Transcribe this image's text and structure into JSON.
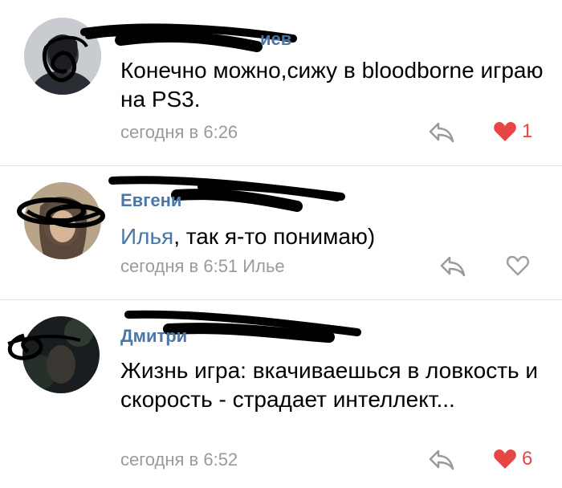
{
  "comments": [
    {
      "name_visible": "иев",
      "text": "Конечно можно,сижу в bloodborne играю на PS3.",
      "time": "сегодня в 6:26",
      "likes": "1",
      "liked": true,
      "icons": {
        "reply": "reply-arrow-icon",
        "like": "heart-filled-icon"
      }
    },
    {
      "name_visible": "Евгени",
      "mention": "Илья",
      "text_after_mention": ", так я-то понимаю)",
      "time": "сегодня в 6:51",
      "reply_to": "Илье",
      "likes": "",
      "liked": false,
      "icons": {
        "reply": "reply-arrow-icon",
        "like": "heart-outline-icon"
      }
    },
    {
      "name_visible": "Дмитри",
      "text": "Жизнь игра:  вкачиваешься в ловкость и скорость - страдает интеллект...",
      "time": "сегодня в 6:52",
      "likes": "6",
      "liked": true,
      "icons": {
        "reply": "reply-arrow-icon",
        "like": "heart-filled-icon"
      }
    }
  ],
  "colors": {
    "name": "#4a76a8",
    "meta": "#9a9a9a",
    "like_active": "#e64646",
    "like_inactive": "#a0a0a0",
    "divider": "#e3e3e3"
  }
}
